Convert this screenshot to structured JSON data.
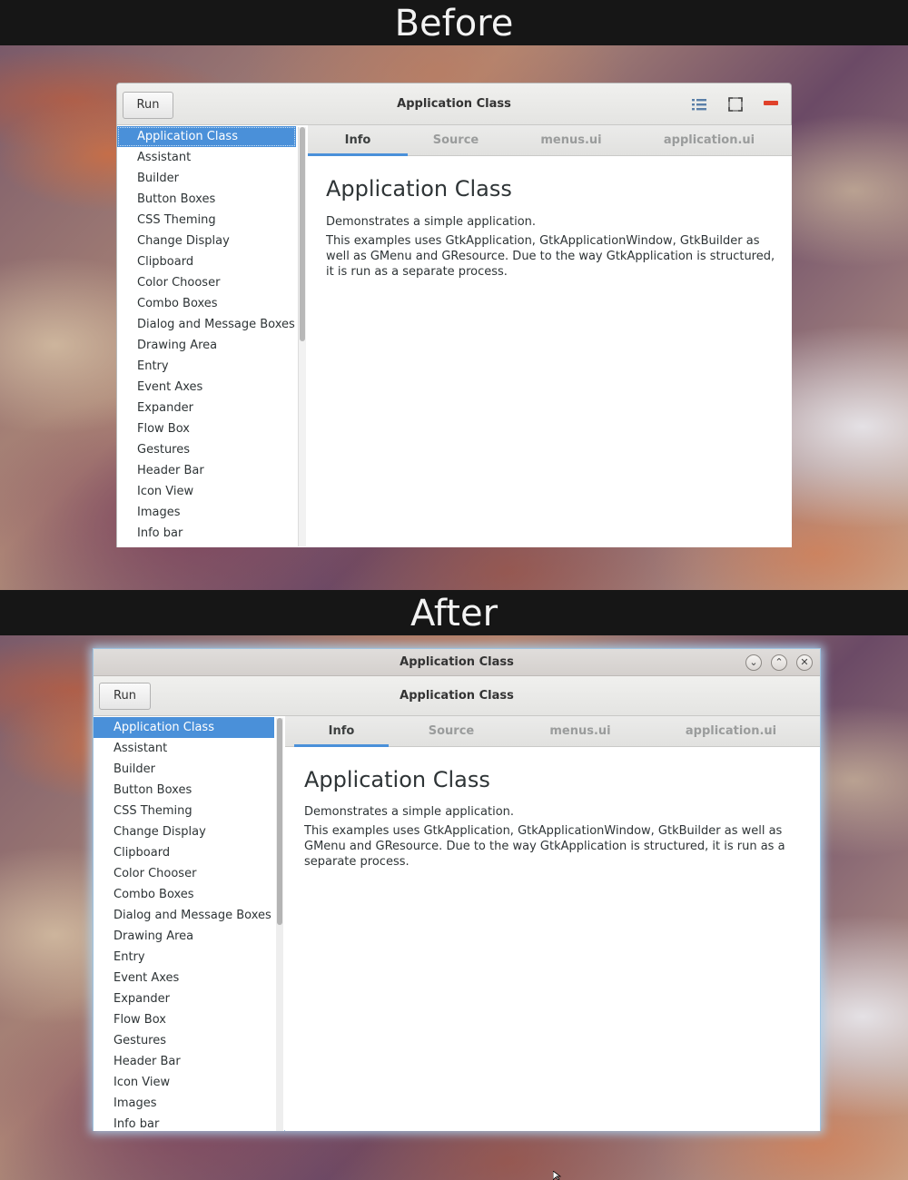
{
  "labels": {
    "before": "Before",
    "after": "After"
  },
  "window": {
    "title": "Application Class",
    "run_label": "Run",
    "wm_buttons": [
      "minimize-icon",
      "maximize-icon",
      "close-icon"
    ]
  },
  "sidebar": {
    "selected": "Application Class",
    "items": [
      "Application Class",
      "Assistant",
      "Builder",
      "Button Boxes",
      "CSS Theming",
      "Change Display",
      "Clipboard",
      "Color Chooser",
      "Combo Boxes",
      "Dialog and Message Boxes",
      "Drawing Area",
      "Entry",
      "Event Axes",
      "Expander",
      "Flow Box",
      "Gestures",
      "Header Bar",
      "Icon View",
      "Images",
      "Info bar"
    ]
  },
  "tabs": [
    "Info",
    "Source",
    "menus.ui",
    "application.ui"
  ],
  "active_tab": "Info",
  "content": {
    "title": "Application Class",
    "line1": "Demonstrates a simple application.",
    "line2": "This examples uses GtkApplication, GtkApplicationWindow, GtkBuilder as well as GMenu and GResource. Due to the way GtkApplication is structured, it is run as a separate process."
  },
  "icons": [
    "list-view-icon",
    "fullscreen-icon",
    "close-bar-icon",
    "mouse-cursor-icon"
  ],
  "colors": {
    "selection": "#4a90d9",
    "close_red": "#e0412a",
    "glow": "#aad2f0"
  }
}
